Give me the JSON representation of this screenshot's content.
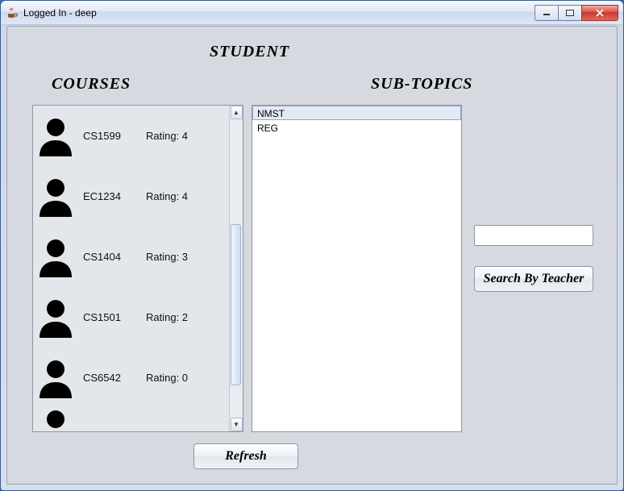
{
  "window": {
    "title": "Logged In - deep"
  },
  "labels": {
    "student": "STUDENT",
    "courses": "COURSES",
    "subtopics": "SUB-TOPICS"
  },
  "courses": [
    {
      "code": "CS1599",
      "rating": "Rating: 4"
    },
    {
      "code": "EC1234",
      "rating": "Rating: 4"
    },
    {
      "code": "CS1404",
      "rating": "Rating: 3"
    },
    {
      "code": "CS1501",
      "rating": "Rating: 2"
    },
    {
      "code": "CS6542",
      "rating": "Rating: 0"
    }
  ],
  "subtopics": [
    {
      "label": "NMST",
      "selected": true
    },
    {
      "label": "REG",
      "selected": false
    }
  ],
  "search": {
    "value": "",
    "button_label": "Search By Teacher"
  },
  "buttons": {
    "refresh": "Refresh"
  }
}
